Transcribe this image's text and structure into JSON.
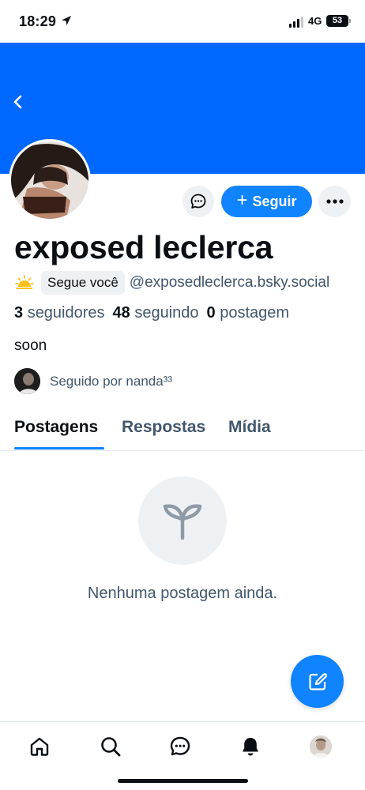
{
  "status_bar": {
    "time": "18:29",
    "network": "4G",
    "battery": "53"
  },
  "profile": {
    "display_name": "exposed leclerca",
    "follows_you_label": "Segue você",
    "handle": "@exposedleclerca.bsky.social",
    "stats": {
      "followers_count": "3",
      "followers_label": "seguidores",
      "following_count": "48",
      "following_label": "seguindo",
      "posts_count": "0",
      "posts_label": "postagem"
    },
    "bio": "soon",
    "followed_by_text": "Seguido por nanda³³"
  },
  "actions": {
    "follow_label": "Seguir"
  },
  "tabs": [
    {
      "label": "Postagens",
      "active": true
    },
    {
      "label": "Respostas",
      "active": false
    },
    {
      "label": "Mídia",
      "active": false
    }
  ],
  "empty_state": {
    "message": "Nenhuma postagem ainda."
  },
  "colors": {
    "banner": "#0068ff",
    "accent": "#1083fe",
    "muted_text": "#42576c",
    "surface": "#eef1f4"
  },
  "icons": {
    "back": "chevron-left-icon",
    "message": "chat-bubble-icon",
    "more": "ellipsis-icon",
    "empty": "sprout-icon",
    "compose": "compose-icon",
    "nav": [
      "home-icon",
      "search-icon",
      "chat-icon",
      "bell-icon",
      "profile-avatar"
    ]
  }
}
